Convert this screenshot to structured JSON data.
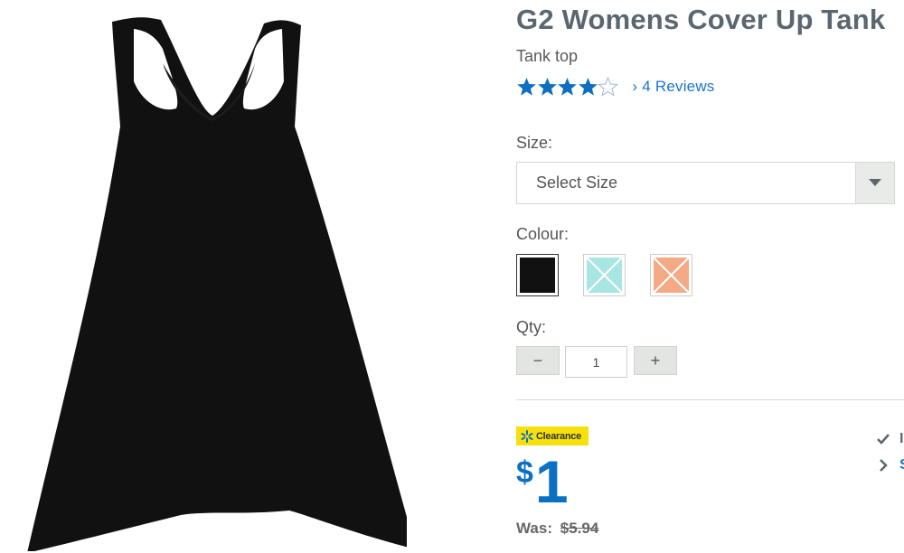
{
  "product": {
    "title": "G2 Womens Cover Up Tank",
    "subtitle": "Tank top",
    "rating": 4,
    "rating_max": 5,
    "reviews_link": "› 4 Reviews",
    "image_icon": "black-racerback-tank-image"
  },
  "size": {
    "label": "Size:",
    "selected": "Select Size",
    "arrow_icon": "chevron-down-icon"
  },
  "colour": {
    "label": "Colour:",
    "swatches": [
      {
        "color": "#111111",
        "selected": true,
        "available": true
      },
      {
        "color": "#a8e6e3",
        "selected": false,
        "available": false
      },
      {
        "color": "#f4aa85",
        "selected": false,
        "available": false
      }
    ]
  },
  "qty": {
    "label": "Qty:",
    "value": "1",
    "decrement": "−",
    "increment": "+"
  },
  "pricing": {
    "badge_text": "Clearance",
    "badge_icon": "spark-icon",
    "currency": "$",
    "price": "1",
    "was_label": "Was:",
    "was_price": "$5.94"
  },
  "colors": {
    "title": "#5b6770",
    "link": "#1a75cf",
    "price": "#0b6fc2",
    "badge": "#f7e10d",
    "star": "#0f6ec0"
  },
  "side": {
    "check_icon": "check-icon",
    "arrow_icon": "chevron-right-icon",
    "check_text": "I",
    "arrow_text": "S"
  }
}
